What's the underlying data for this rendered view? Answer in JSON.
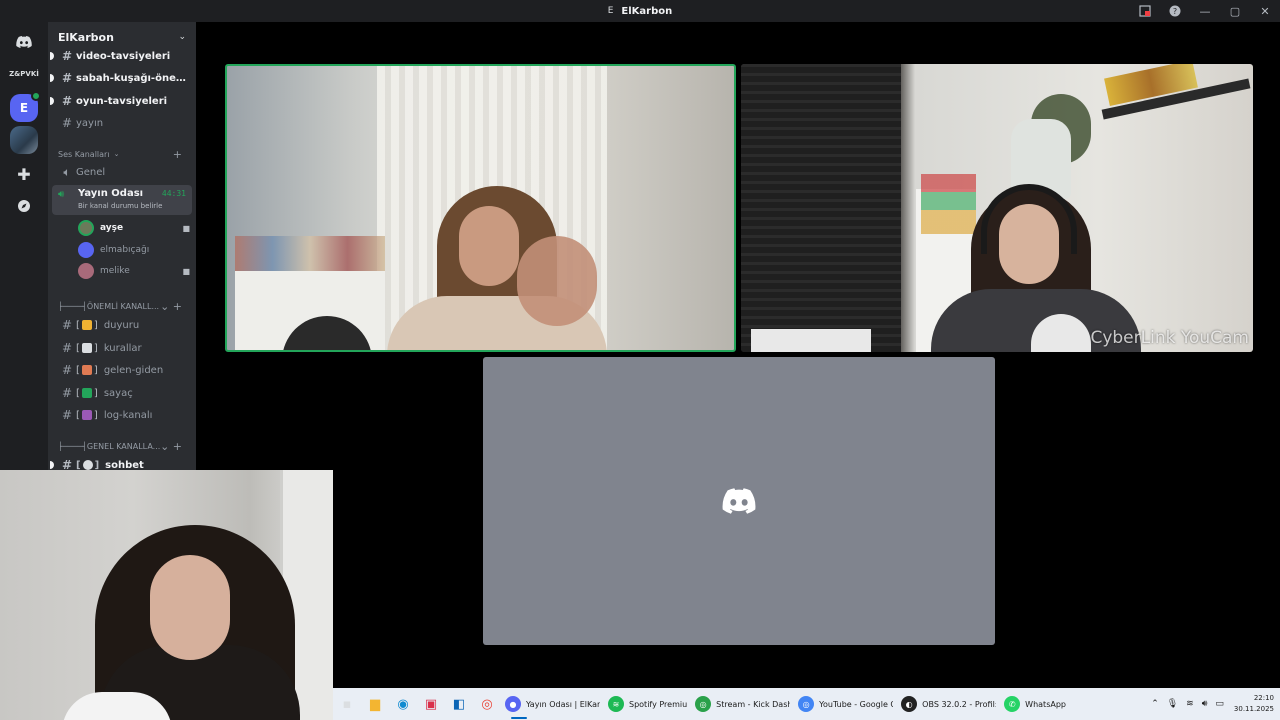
{
  "window": {
    "app_icon_letter": "E",
    "title": "ElKarbon"
  },
  "rail": {
    "server_abbrev": "Z&PVKİ",
    "active_server_letter": "E"
  },
  "server": {
    "name": "ElKarbon",
    "channels_top": [
      {
        "name": "video-tavsiyeleri",
        "unread": true
      },
      {
        "name": "sabah-kuşağı-öneril...",
        "unread": true
      },
      {
        "name": "oyun-tavsiyeleri",
        "unread": true
      },
      {
        "name": "yayın",
        "unread": false
      }
    ],
    "voice_category": "Ses Kanalları",
    "voice_channels": [
      {
        "name": "Genel"
      }
    ],
    "active_voice": {
      "name": "Yayın Odası",
      "timer": "44:31",
      "status": "Bir kanal durumu belirle"
    },
    "voice_users": [
      {
        "name": "ayşe",
        "camera": true
      },
      {
        "name": "elmabıçağı",
        "camera": false
      },
      {
        "name": "melike",
        "camera": true
      }
    ],
    "category_important": "├────┤ÖNEMLİ KANALL...",
    "important_channels": [
      {
        "name": "duyuru",
        "emoji_color": "#f0b232"
      },
      {
        "name": "kurallar",
        "emoji_color": "#dbdee1"
      },
      {
        "name": "gelen-giden",
        "emoji_color": "#e07b53"
      },
      {
        "name": "sayaç",
        "emoji_color": "#23a55a"
      },
      {
        "name": "log-kanalı",
        "emoji_color": "#9b59b6"
      }
    ],
    "category_general": "├────┤GENEL KANALLA...",
    "general_channels": [
      {
        "name": "sohbet",
        "unread": true
      }
    ]
  },
  "stage": {
    "watermark": "CyberLink YouCam"
  },
  "taskbar": {
    "apps": [
      {
        "label": "Yayın Odası | ElKarbc",
        "color": "#5865f2"
      },
      {
        "label": "Spotify Premiu",
        "color": "#1db954"
      },
      {
        "label": "Stream - Kick Dashb",
        "color": "#2aa14a"
      },
      {
        "label": "YouTube - Google Cl",
        "color": "#4285f4"
      },
      {
        "label": "OBS 32.0.2 - Profil: I",
        "color": "#222222"
      },
      {
        "label": "WhatsApp",
        "color": "#25d366"
      }
    ],
    "time": "22:10",
    "date": "30.11.2025"
  }
}
